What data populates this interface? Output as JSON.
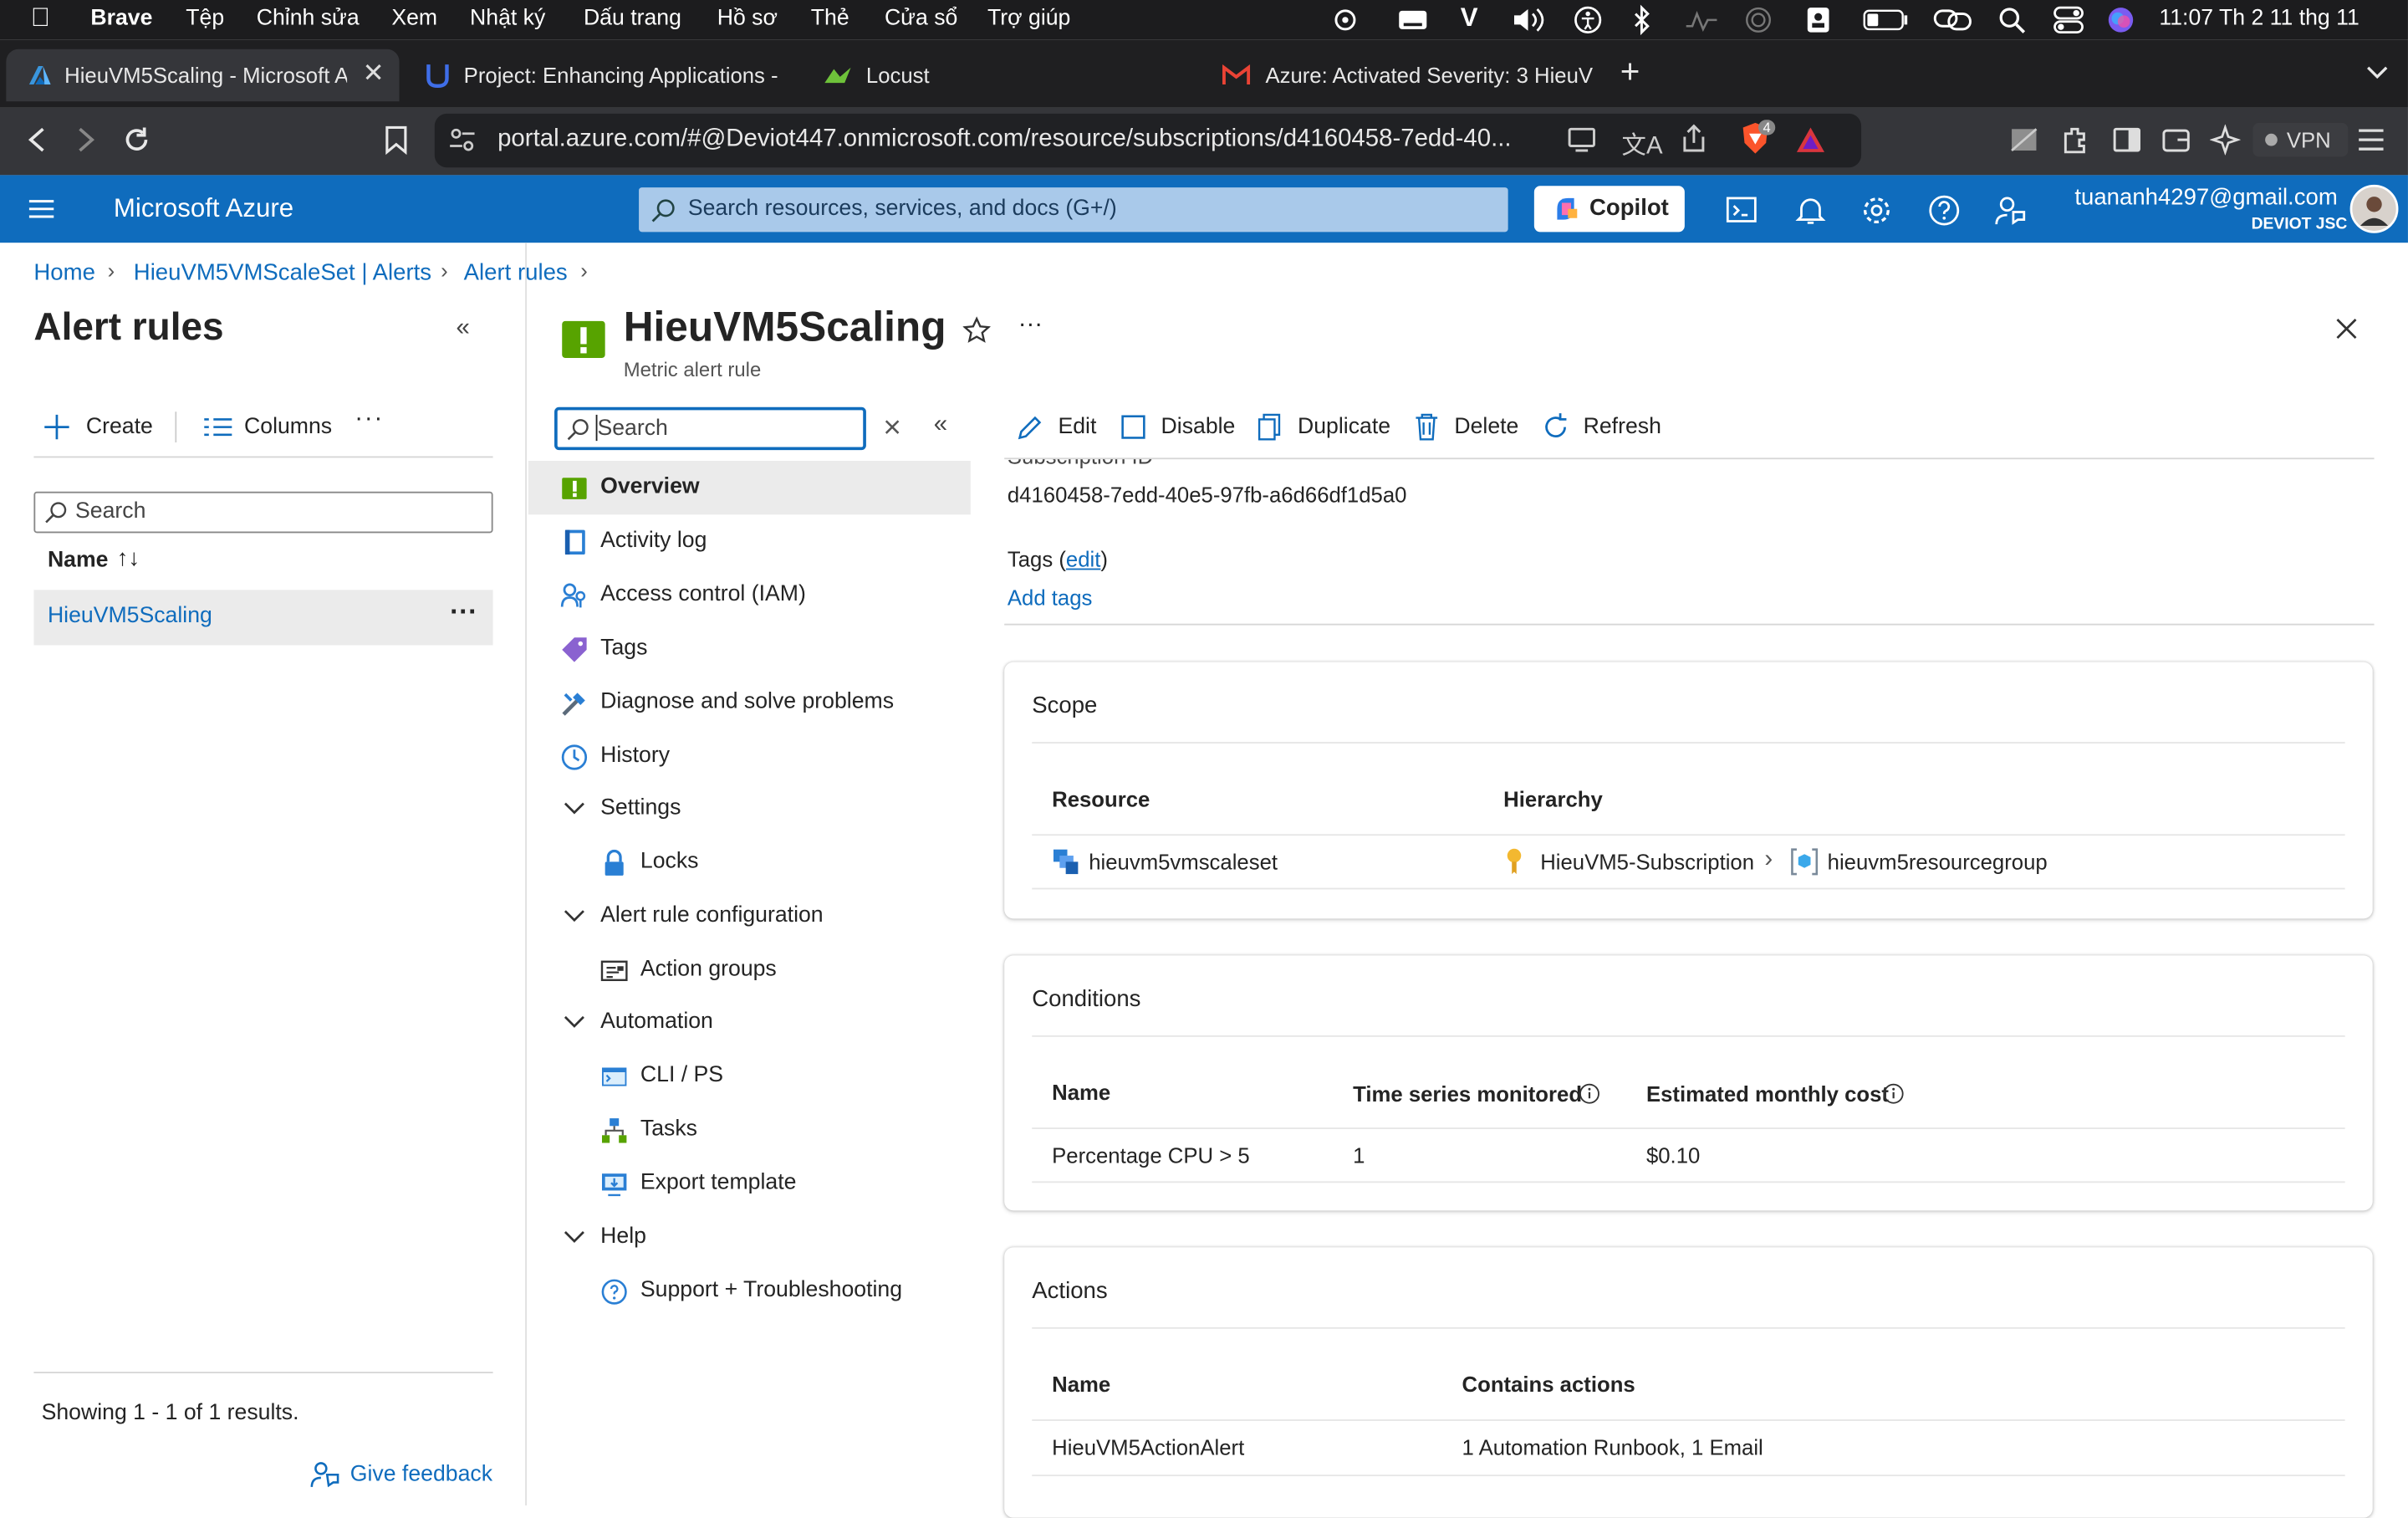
{
  "menubar": {
    "app": "Brave",
    "items": [
      "Tệp",
      "Chỉnh sửa",
      "Xem",
      "Nhật ký",
      "Dấu trang",
      "Hồ sơ",
      "Thẻ",
      "Cửa sổ",
      "Trợ giúp"
    ],
    "clock": "11:07 Th 2 11 thg 11"
  },
  "tabs": [
    {
      "title": "HieuVM5Scaling - Microsoft A"
    },
    {
      "title": "Project: Enhancing Applications -"
    },
    {
      "title": "Locust"
    },
    {
      "title": "Azure: Activated Severity: 3 HieuV"
    }
  ],
  "address": {
    "url": "portal.azure.com/#@Deviot447.onmicrosoft.com/resource/subscriptions/d4160458-7edd-40...",
    "brave_badge": "4",
    "vpn_label": "VPN"
  },
  "azure_header": {
    "brand": "Microsoft Azure",
    "search_placeholder": "Search resources, services, and docs (G+/)",
    "copilot_label": "Copilot",
    "account_email": "tuananh4297@gmail.com",
    "account_org": "DEVIOT JSC"
  },
  "breadcrumb": [
    "Home",
    "HieuVM5VMScaleSet | Alerts",
    "Alert rules"
  ],
  "left_panel": {
    "title": "Alert rules",
    "create_label": "Create",
    "columns_label": "Columns",
    "search_placeholder": "Search",
    "name_header": "Name",
    "rows": [
      "HieuVM5Scaling"
    ],
    "footer_text": "Showing 1 - 1 of 1 results.",
    "feedback_label": "Give feedback"
  },
  "resource": {
    "name": "HieuVM5Scaling",
    "type": "Metric alert rule"
  },
  "menu": {
    "search_placeholder": "Search",
    "items": [
      {
        "label": "Overview"
      },
      {
        "label": "Activity log"
      },
      {
        "label": "Access control (IAM)"
      },
      {
        "label": "Tags"
      },
      {
        "label": "Diagnose and solve problems"
      },
      {
        "label": "History"
      },
      {
        "label": "Settings"
      },
      {
        "label": "Locks"
      },
      {
        "label": "Alert rule configuration"
      },
      {
        "label": "Action groups"
      },
      {
        "label": "Automation"
      },
      {
        "label": "CLI / PS"
      },
      {
        "label": "Tasks"
      },
      {
        "label": "Export template"
      },
      {
        "label": "Help"
      },
      {
        "label": "Support + Troubleshooting"
      }
    ]
  },
  "toolbar": {
    "edit": "Edit",
    "disable": "Disable",
    "duplicate": "Duplicate",
    "delete": "Delete",
    "refresh": "Refresh"
  },
  "essentials": {
    "subscription_label": "Subscription ID",
    "subscription_id": "d4160458-7edd-40e5-97fb-a6d66df1d5a0",
    "tags_label": "Tags (",
    "tags_edit": "edit",
    "tags_close": ")",
    "add_tags": "Add tags"
  },
  "scope": {
    "title": "Scope",
    "headers": [
      "Resource",
      "Hierarchy"
    ],
    "resource": "hieuvm5vmscaleset",
    "subscription": "HieuVM5-Subscription",
    "resource_group": "hieuvm5resourcegroup"
  },
  "conditions": {
    "title": "Conditions",
    "headers": [
      "Name",
      "Time series monitored",
      "Estimated monthly cost"
    ],
    "row": [
      "Percentage CPU > 5",
      "1",
      "$0.10"
    ]
  },
  "actions": {
    "title": "Actions",
    "headers": [
      "Name",
      "Contains actions"
    ],
    "row": [
      "HieuVM5ActionAlert",
      "1 Automation Runbook, 1 Email"
    ]
  },
  "colors": {
    "azure_blue": "#0f6cbd",
    "alert_green": "#57a300",
    "selected_row": "#ebebeb"
  }
}
